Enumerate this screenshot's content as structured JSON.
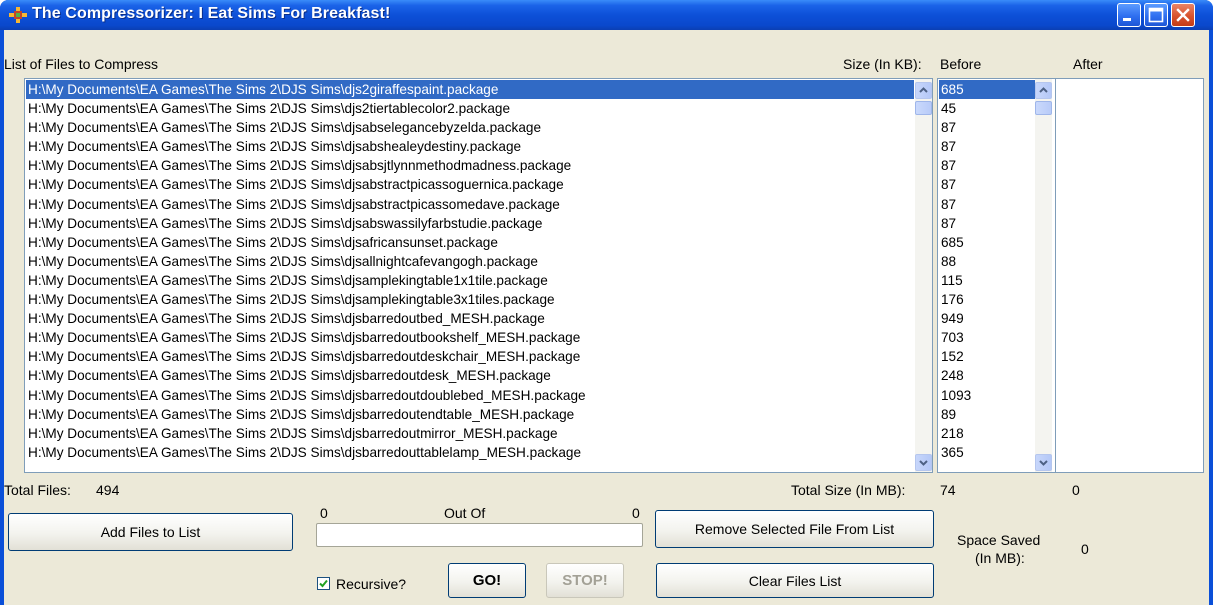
{
  "window": {
    "title": "The Compressorizer: I Eat Sims For Breakfast!"
  },
  "headers": {
    "list_label": "List of Files to Compress",
    "size_label": "Size (In KB):",
    "before": "Before",
    "after": "After"
  },
  "files": [
    {
      "path": "H:\\My Documents\\EA Games\\The Sims 2\\DJS Sims\\djs2giraffespaint.package",
      "size": "685",
      "selected": true
    },
    {
      "path": "H:\\My Documents\\EA Games\\The Sims 2\\DJS Sims\\djs2tiertablecolor2.package",
      "size": "45"
    },
    {
      "path": "H:\\My Documents\\EA Games\\The Sims 2\\DJS Sims\\djsabselegancebyzelda.package",
      "size": "87"
    },
    {
      "path": "H:\\My Documents\\EA Games\\The Sims 2\\DJS Sims\\djsabshealeydestiny.package",
      "size": "87"
    },
    {
      "path": "H:\\My Documents\\EA Games\\The Sims 2\\DJS Sims\\djsabsjtlynnmethodmadness.package",
      "size": "87"
    },
    {
      "path": "H:\\My Documents\\EA Games\\The Sims 2\\DJS Sims\\djsabstractpicassoguernica.package",
      "size": "87"
    },
    {
      "path": "H:\\My Documents\\EA Games\\The Sims 2\\DJS Sims\\djsabstractpicassomedave.package",
      "size": "87"
    },
    {
      "path": "H:\\My Documents\\EA Games\\The Sims 2\\DJS Sims\\djsabswassilyfarbstudie.package",
      "size": "87"
    },
    {
      "path": "H:\\My Documents\\EA Games\\The Sims 2\\DJS Sims\\djsafricansunset.package",
      "size": "685"
    },
    {
      "path": "H:\\My Documents\\EA Games\\The Sims 2\\DJS Sims\\djsallnightcafevangogh.package",
      "size": "88"
    },
    {
      "path": "H:\\My Documents\\EA Games\\The Sims 2\\DJS Sims\\djsamplekingtable1x1tile.package",
      "size": "115"
    },
    {
      "path": "H:\\My Documents\\EA Games\\The Sims 2\\DJS Sims\\djsamplekingtable3x1tiles.package",
      "size": "176"
    },
    {
      "path": "H:\\My Documents\\EA Games\\The Sims 2\\DJS Sims\\djsbarredoutbed_MESH.package",
      "size": "949"
    },
    {
      "path": "H:\\My Documents\\EA Games\\The Sims 2\\DJS Sims\\djsbarredoutbookshelf_MESH.package",
      "size": "703"
    },
    {
      "path": "H:\\My Documents\\EA Games\\The Sims 2\\DJS Sims\\djsbarredoutdeskchair_MESH.package",
      "size": "152"
    },
    {
      "path": "H:\\My Documents\\EA Games\\The Sims 2\\DJS Sims\\djsbarredoutdesk_MESH.package",
      "size": "248"
    },
    {
      "path": "H:\\My Documents\\EA Games\\The Sims 2\\DJS Sims\\djsbarredoutdoublebed_MESH.package",
      "size": "1093"
    },
    {
      "path": "H:\\My Documents\\EA Games\\The Sims 2\\DJS Sims\\djsbarredoutendtable_MESH.package",
      "size": "89"
    },
    {
      "path": "H:\\My Documents\\EA Games\\The Sims 2\\DJS Sims\\djsbarredoutmirror_MESH.package",
      "size": "218"
    },
    {
      "path": "H:\\My Documents\\EA Games\\The Sims 2\\DJS Sims\\djsbarredouttablelamp_MESH.package",
      "size": "365"
    }
  ],
  "stats": {
    "total_files_label": "Total Files:",
    "total_files": "494",
    "total_size_label": "Total Size (In MB):",
    "total_size_before": "74",
    "total_size_after": "0"
  },
  "progress": {
    "current": "0",
    "out_of_label": "Out Of",
    "total": "0",
    "fraction": 0
  },
  "buttons": {
    "add_files": "Add Files to List",
    "remove_selected": "Remove Selected File From List",
    "go": "GO!",
    "stop": "STOP!",
    "clear_list": "Clear Files List"
  },
  "options": {
    "recursive_label": "Recursive?",
    "recursive_checked": true
  },
  "space_saved": {
    "label_line1": "Space Saved",
    "label_line2": "(In MB):",
    "value": "0"
  },
  "colors": {
    "title_bar": "#0a4fd8",
    "selection": "#316ac5",
    "dialog_face": "#ece9d8"
  }
}
